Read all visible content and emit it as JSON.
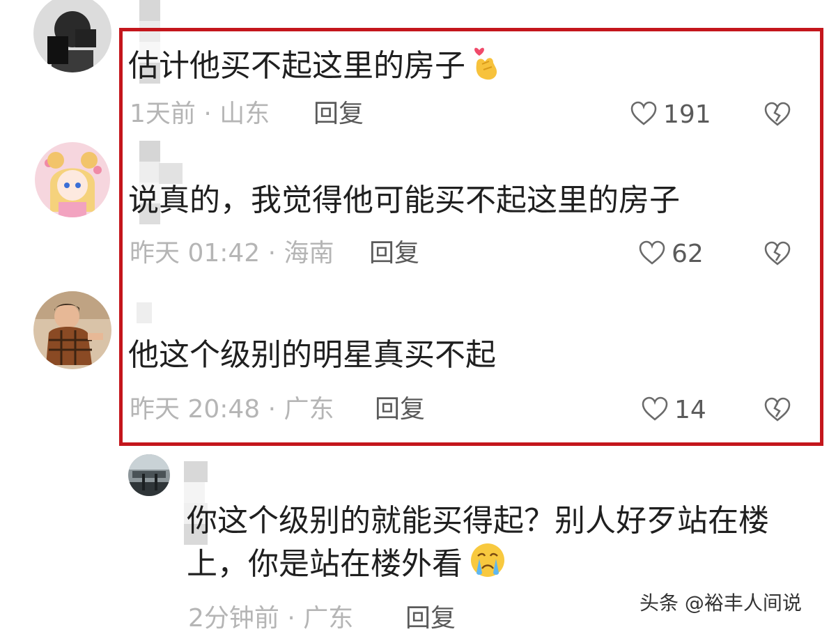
{
  "comments": [
    {
      "text": "估计他买不起这里的房子",
      "emoji": "finger-heart-emoji",
      "meta": "1天前 · 山东",
      "reply": "回复",
      "likes": "191"
    },
    {
      "text": "说真的，我觉得他可能买不起这里的房子",
      "meta": "昨天 01:42 · 海南",
      "reply": "回复",
      "likes": "62"
    },
    {
      "text": "他这个级别的明星真买不起",
      "meta": "昨天 20:48 · 广东",
      "reply": "回复",
      "likes": "14"
    }
  ],
  "sub_reply": {
    "text": "你这个级别的就能买得起？别人好歹站在楼上，你是站在楼外看",
    "emoji": "crying-face-emoji",
    "meta": "2分钟前 · 广东",
    "reply": "回复"
  },
  "watermark": "头条 @裕丰人间说",
  "colors": {
    "highlight": "#c4161c",
    "meta_text": "#b5b5b5",
    "action_text": "#5a5a5a"
  }
}
